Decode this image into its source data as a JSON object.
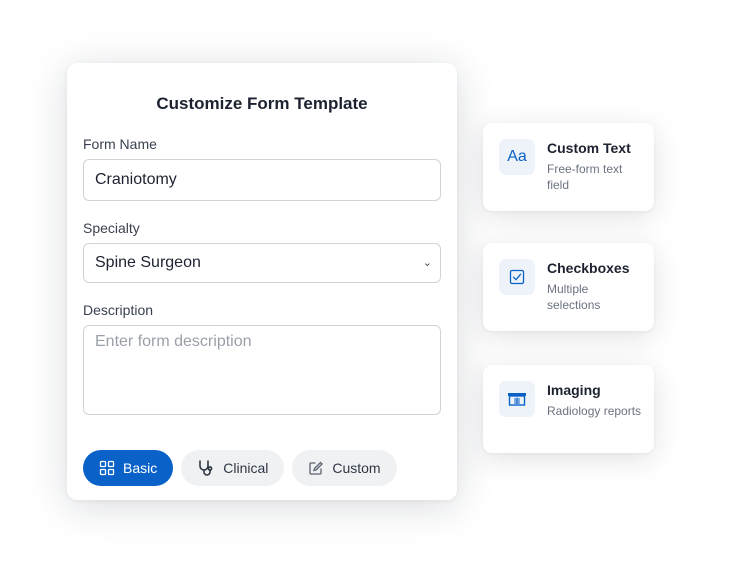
{
  "form": {
    "title": "Customize Form Template",
    "name_label": "Form Name",
    "name_value": "Craniotomy",
    "specialty_label": "Specialty",
    "specialty_value": "Spine Surgeon",
    "description_label": "Description",
    "description_placeholder": "Enter form description",
    "chips": [
      {
        "label": "Basic",
        "icon": "grid-icon",
        "active": true
      },
      {
        "label": "Clinical",
        "icon": "stethoscope-icon",
        "active": false
      },
      {
        "label": "Custom",
        "icon": "edit-icon",
        "active": false
      }
    ]
  },
  "field_types": [
    {
      "title": "Custom Text",
      "description": "Free-form text field",
      "icon": "text-aa-icon",
      "icon_glyph": "Aa"
    },
    {
      "title": "Checkboxes",
      "description": "Multiple selections",
      "icon": "checkbox-icon"
    },
    {
      "title": "Imaging",
      "description": "Radiology reports",
      "icon": "xray-icon"
    }
  ],
  "colors": {
    "accent": "#0a62c9",
    "chip_inactive_bg": "#f0f1f3",
    "icon_box_bg": "#eef3fa"
  }
}
